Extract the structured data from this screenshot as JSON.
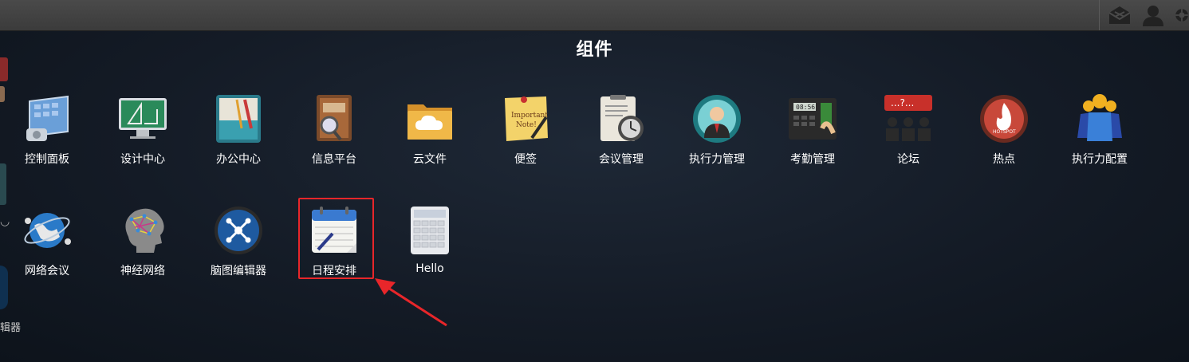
{
  "window_title": "组件",
  "apps_row1": [
    {
      "label": "控制面板",
      "icon": "control-panel-icon"
    },
    {
      "label": "设计中心",
      "icon": "design-center-icon"
    },
    {
      "label": "办公中心",
      "icon": "office-center-icon"
    },
    {
      "label": "信息平台",
      "icon": "info-platform-icon"
    },
    {
      "label": "云文件",
      "icon": "cloud-folder-icon"
    },
    {
      "label": "便签",
      "icon": "sticky-note-icon"
    },
    {
      "label": "会议管理",
      "icon": "meeting-management-icon"
    },
    {
      "label": "执行力管理",
      "icon": "execution-management-icon"
    },
    {
      "label": "考勤管理",
      "icon": "attendance-icon"
    },
    {
      "label": "论坛",
      "icon": "forum-icon"
    },
    {
      "label": "热点",
      "icon": "hotspot-icon"
    },
    {
      "label": "执行力配置",
      "icon": "execution-config-icon"
    }
  ],
  "apps_row2": [
    {
      "label": "网络会议",
      "icon": "web-meeting-icon"
    },
    {
      "label": "神经网络",
      "icon": "neural-network-icon"
    },
    {
      "label": "脑图编辑器",
      "icon": "mindmap-editor-icon"
    },
    {
      "label": "日程安排",
      "icon": "calendar-icon"
    },
    {
      "label": "Hello",
      "icon": "calculator-icon"
    }
  ],
  "background_partial_text": "辑器",
  "highlighted_app": "日程安排",
  "colors": {
    "highlight": "#e8262a",
    "arrow": "#e8262a",
    "text": "#ffffff"
  }
}
